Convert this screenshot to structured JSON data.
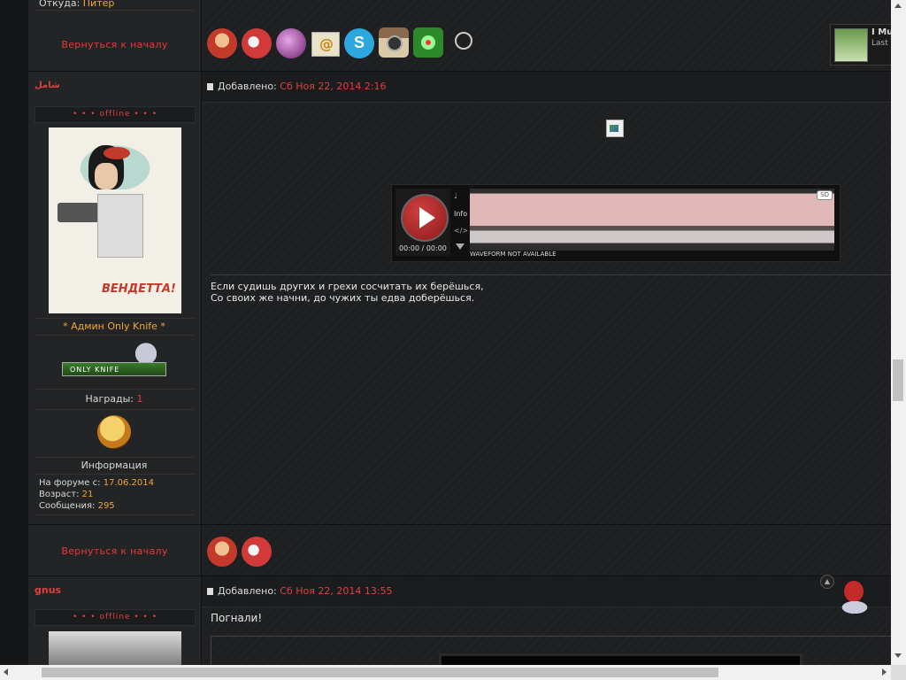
{
  "top_post": {
    "location_label": "Откуда:",
    "location_value": "Питер",
    "back_to_top": "Вернуться к началу",
    "social_icons": [
      "profile-icon",
      "message-icon",
      "website-icon",
      "email-icon",
      "skype-icon",
      "instagram-icon",
      "icq-icon",
      "steam-icon"
    ],
    "steam_widget": {
      "name": "I Mu",
      "status": "Last"
    }
  },
  "post1": {
    "username": "شامل",
    "status": "• • • offline • • •",
    "rank": "* Админ Only Knife *",
    "rank_badge_text": "ONLY KNIFE",
    "awards_label": "Награды:",
    "awards_count": "1",
    "info_label": "Информация",
    "joined_label": "На форуме с:",
    "joined_value": "17.06.2014",
    "age_label": "Возраст:",
    "age_value": "21",
    "posts_label": "Сообщения:",
    "posts_value": "295",
    "added_label": "Добавлено:",
    "added_date": "Сб Ноя 22, 2014 2:16",
    "player": {
      "time": "00:00 / 00:00",
      "info": "Info",
      "embed": "</>",
      "quality": "SD",
      "waveform_note": "WAVEFORM NOT AVAILABLE"
    },
    "text_line1": "Если судишь других и грехи сосчитать их берёшься,",
    "text_line2": "Со своих же начни, до чужих ты едва доберёшься.",
    "back_to_top": "Вернуться к началу",
    "social_icons": [
      "profile-icon",
      "message-icon"
    ]
  },
  "post2": {
    "username": "gnus",
    "status": "• • • offline • • •",
    "added_label": "Добавлено:",
    "added_date": "Сб Ноя 22, 2014 13:55",
    "text": "Погнали!"
  },
  "colors": {
    "accent_red": "#e04040",
    "accent_orange": "#f0a63a",
    "background": "#1c1e20"
  }
}
